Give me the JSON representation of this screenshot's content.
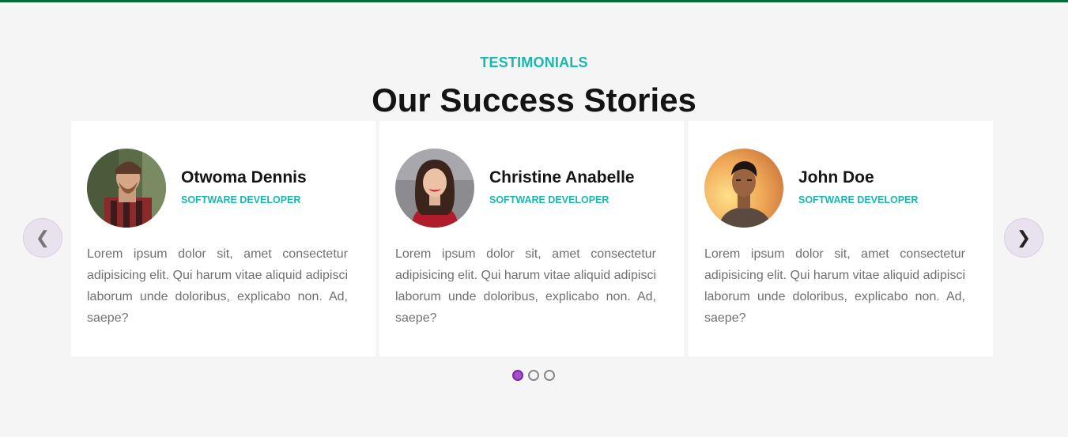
{
  "section": {
    "eyebrow": "TESTIMONIALS",
    "title": "Our Success Stories"
  },
  "testimonials": [
    {
      "name": "Otwoma Dennis",
      "role": "SOFTWARE DEVELOPER",
      "text": "Lorem ipsum dolor sit, amet consectetur adipisicing elit. Qui harum vitae aliquid adipisci laborum unde doloribus, explicabo non. Ad, saepe?"
    },
    {
      "name": "Christine Anabelle",
      "role": "SOFTWARE DEVELOPER",
      "text": "Lorem ipsum dolor sit, amet consectetur adipisicing elit. Qui harum vitae aliquid adipisci laborum unde doloribus, explicabo non. Ad, saepe?"
    },
    {
      "name": "John Doe",
      "role": "SOFTWARE DEVELOPER",
      "text": "Lorem ipsum dolor sit, amet consectetur adipisicing elit. Qui harum vitae aliquid adipisci laborum unde doloribus, explicabo non. Ad, saepe?"
    }
  ],
  "carousel": {
    "prev_icon": "chevron-left-icon",
    "next_icon": "chevron-right-icon",
    "prev_glyph": "❮",
    "next_glyph": "❯",
    "active_slide": 1,
    "slide_count": 3
  },
  "colors": {
    "accent": "#19b7ae",
    "top_bar": "#0a6b3a",
    "active_dot": "#a24fc9"
  }
}
